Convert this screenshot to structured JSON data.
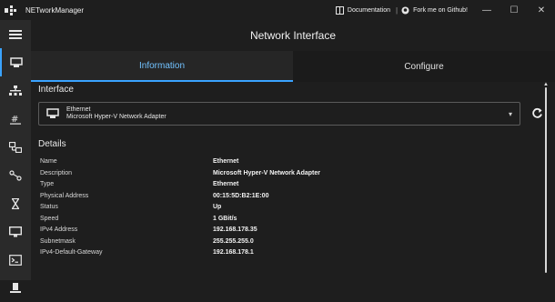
{
  "window": {
    "title": "NETworkManager",
    "documentation_label": "Documentation",
    "separator": "|",
    "github_label": "Fork me on Github!",
    "minimize": "—",
    "maximize": "☐",
    "close": "✕"
  },
  "header": {
    "title": "Network Interface"
  },
  "tabs": [
    {
      "label": "Information",
      "active": true
    },
    {
      "label": "Configure",
      "active": false
    }
  ],
  "interface": {
    "section_title": "Interface",
    "selected_name": "Ethernet",
    "selected_description": "Microsoft Hyper-V Network Adapter"
  },
  "details": {
    "section_title": "Details",
    "rows": [
      {
        "label": "Name",
        "value": "Ethernet"
      },
      {
        "label": "Description",
        "value": "Microsoft Hyper-V Network Adapter"
      },
      {
        "label": "Type",
        "value": "Ethernet"
      },
      {
        "label": "Physical Address",
        "value": "00:15:5D:B2:1E:00"
      },
      {
        "label": "Status",
        "value": "Up"
      },
      {
        "label": "Speed",
        "value": "1 GBit/s"
      },
      {
        "label": "IPv4 Address",
        "value": "192.168.178.35"
      },
      {
        "label": "Subnetmask",
        "value": "255.255.255.0"
      },
      {
        "label": "IPv4-Default-Gateway",
        "value": "192.168.178.1"
      }
    ]
  },
  "sidebar": {
    "items": [
      {
        "icon": "menu-icon",
        "active": false
      },
      {
        "icon": "network-card-icon",
        "active": true
      },
      {
        "icon": "network-tree-icon",
        "active": false
      },
      {
        "icon": "ip-scanner-icon",
        "active": false
      },
      {
        "icon": "port-scanner-icon",
        "active": false
      },
      {
        "icon": "route-icon",
        "active": false
      },
      {
        "icon": "hourglass-icon",
        "active": false
      },
      {
        "icon": "monitor-icon",
        "active": false
      },
      {
        "icon": "terminal-icon",
        "active": false
      },
      {
        "icon": "server-icon",
        "active": false
      }
    ]
  },
  "colors": {
    "accent": "#3aa3ff",
    "active_tab_text": "#71c2ff",
    "background": "#1e1e1e",
    "sidebar": "#2a2a2a"
  }
}
